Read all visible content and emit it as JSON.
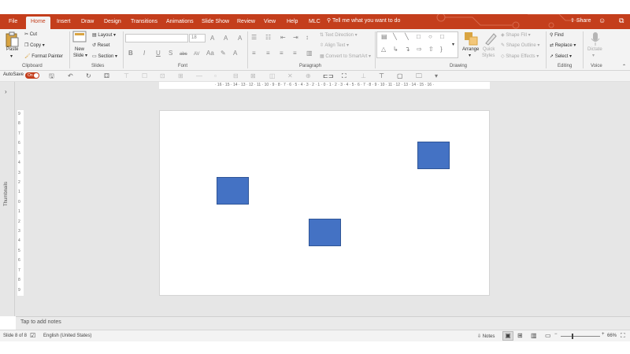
{
  "tabs": [
    {
      "label": "File",
      "active": false
    },
    {
      "label": "Home",
      "active": true
    },
    {
      "label": "Insert",
      "active": false
    },
    {
      "label": "Draw",
      "active": false
    },
    {
      "label": "Design",
      "active": false
    },
    {
      "label": "Transitions",
      "active": false
    },
    {
      "label": "Animations",
      "active": false
    },
    {
      "label": "Slide Show",
      "active": false
    },
    {
      "label": "Review",
      "active": false
    },
    {
      "label": "View",
      "active": false
    },
    {
      "label": "Help",
      "active": false
    },
    {
      "label": "MLC",
      "active": false
    }
  ],
  "tell_me": "Tell me what you want to do",
  "share_label": "Share",
  "ribbon": {
    "clipboard": {
      "paste": "Paste",
      "cut": "Cut",
      "copy": "Copy",
      "format_painter": "Format Painter",
      "label": "Clipboard"
    },
    "slides": {
      "new_slide_1": "New",
      "new_slide_2": "Slide",
      "layout": "Layout",
      "reset": "Reset",
      "section": "Section",
      "label": "Slides"
    },
    "font": {
      "font_size": "18",
      "label": "Font",
      "bold": "B",
      "italic": "I",
      "underline": "U",
      "shadow": "S",
      "strike": "abc",
      "spacing": "AV",
      "case": "Aa",
      "grow": "A",
      "shrink": "A",
      "clear": "A"
    },
    "paragraph": {
      "text_direction": "Text Direction",
      "align_text": "Align Text",
      "smartart": "Convert to SmartArt",
      "label": "Paragraph"
    },
    "drawing": {
      "arrange": "Arrange",
      "quick_1": "Quick",
      "quick_2": "Styles",
      "shape_fill": "Shape Fill",
      "shape_outline": "Shape Outline",
      "shape_effects": "Shape Effects",
      "label": "Drawing"
    },
    "editing": {
      "find": "Find",
      "replace": "Replace",
      "select": "Select",
      "label": "Editing"
    },
    "voice": {
      "dictate": "Dictate",
      "label": "Voice"
    }
  },
  "qat": {
    "autosave": "AutoSave",
    "toggle": "On"
  },
  "ruler": {
    "horizontal": "· 16 · 15 · 14 · 13 · 12 · 11 · 10 · 9 · 8 · 7 · 6 · 5 · 4 · 3 · 2 · 1 · 0 · 1 · 2 · 3 · 4 · 5 · 6 · 7 · 8 · 9 · 10 · 11 · 12 · 13 · 14 · 15 · 16 ·",
    "vertical": [
      "9",
      "8",
      "7",
      "6",
      "5",
      "4",
      "3",
      "2",
      "1",
      "0",
      "1",
      "2",
      "3",
      "4",
      "5",
      "6",
      "7",
      "8",
      "9"
    ]
  },
  "thumbnails_label": "Thumbnails",
  "notes_placeholder": "Tap to add notes",
  "status": {
    "slide": "Slide 8 of 8",
    "language": "English (United States)",
    "notes": "Notes",
    "zoom": "66%"
  },
  "colors": {
    "accent": "#c43e1c",
    "shape_fill": "#4472c4",
    "shape_border": "#2f5597"
  },
  "slide": {
    "shape_count": 3
  }
}
